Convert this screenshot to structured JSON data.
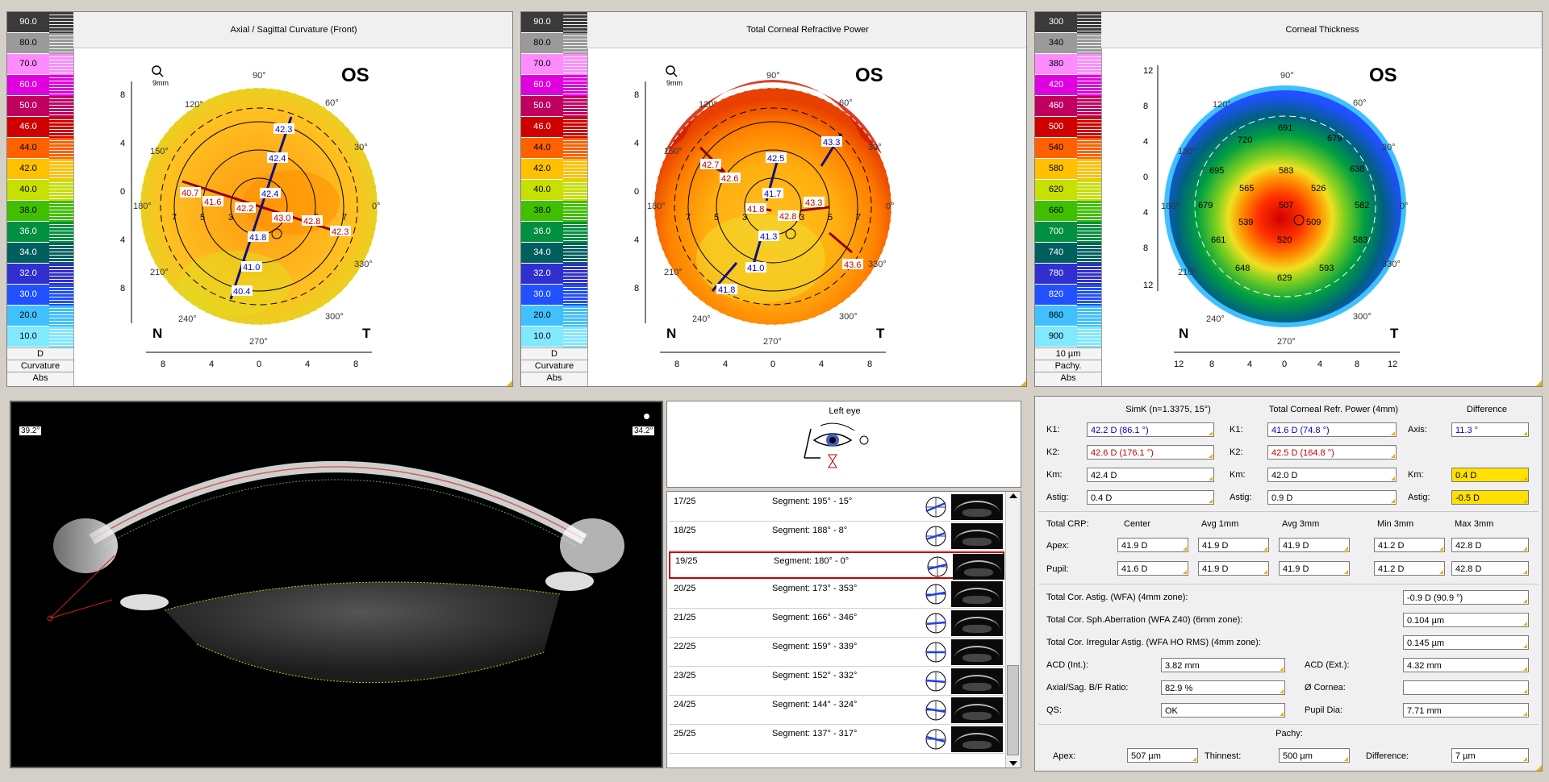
{
  "maps": [
    {
      "title": "Axial / Sagittal Curvature (Front)",
      "eye": "OS",
      "zoom": "9mm",
      "nasal": "N",
      "temporal": "T",
      "scale": [
        "90.0",
        "80.0",
        "70.0",
        "60.0",
        "50.0",
        "46.0",
        "44.0",
        "42.0",
        "40.0",
        "38.0",
        "36.0",
        "34.0",
        "32.0",
        "30.0",
        "20.0",
        "10.0"
      ],
      "scale_colors": [
        "#3a3a3a",
        "#9a9a9a",
        "#ff8cff",
        "#e000e0",
        "#c00060",
        "#d00000",
        "#ff6000",
        "#ffc000",
        "#c8e000",
        "#40c000",
        "#009040",
        "#006060",
        "#3030d0",
        "#2050ff",
        "#40c0ff",
        "#80e8ff"
      ],
      "scale_footer": [
        "D",
        "Curvature",
        "Abs"
      ],
      "x_ticks": [
        "8",
        "4",
        "0",
        "4",
        "8"
      ],
      "y_ticks": [
        "8",
        "4",
        "0",
        "4",
        "8"
      ],
      "angles": [
        "90°",
        "60°",
        "30°",
        "0°",
        "330°",
        "300°",
        "270°",
        "240°",
        "210°",
        "180°",
        "150°",
        "120°"
      ],
      "ring_labels": [
        "7",
        "5",
        "3",
        "3",
        "5",
        "7"
      ],
      "values": [
        "42.3",
        "42.4",
        "42.4",
        "41.8",
        "41.0",
        "40.4",
        "40.7",
        "41.6",
        "42.2",
        "43.0",
        "42.8",
        "42.3"
      ]
    },
    {
      "title": "Total Corneal Refractive Power",
      "eye": "OS",
      "zoom": "9mm",
      "nasal": "N",
      "temporal": "T",
      "scale": [
        "90.0",
        "80.0",
        "70.0",
        "60.0",
        "50.0",
        "46.0",
        "44.0",
        "42.0",
        "40.0",
        "38.0",
        "36.0",
        "34.0",
        "32.0",
        "30.0",
        "20.0",
        "10.0"
      ],
      "scale_colors": [
        "#3a3a3a",
        "#9a9a9a",
        "#ff8cff",
        "#e000e0",
        "#c00060",
        "#d00000",
        "#ff6000",
        "#ffc000",
        "#c8e000",
        "#40c000",
        "#009040",
        "#006060",
        "#3030d0",
        "#2050ff",
        "#40c0ff",
        "#80e8ff"
      ],
      "scale_footer": [
        "D",
        "Curvature",
        "Abs"
      ],
      "x_ticks": [
        "8",
        "4",
        "0",
        "4",
        "8"
      ],
      "y_ticks": [
        "8",
        "4",
        "0",
        "4",
        "8"
      ],
      "angles": [
        "90°",
        "60°",
        "30°",
        "0°",
        "330°",
        "300°",
        "270°",
        "240°",
        "210°",
        "180°",
        "150°",
        "120°"
      ],
      "ring_labels": [
        "7",
        "5",
        "3",
        "3",
        "5",
        "7"
      ],
      "values": [
        "43.3",
        "42.5",
        "41.7",
        "41.3",
        "41.0",
        "41.8",
        "42.7",
        "42.6",
        "41.8",
        "42.8",
        "43.3",
        "43.6"
      ]
    },
    {
      "title": "Corneal Thickness",
      "eye": "OS",
      "nasal": "N",
      "temporal": "T",
      "scale": [
        "300",
        "340",
        "380",
        "420",
        "460",
        "500",
        "540",
        "580",
        "620",
        "660",
        "700",
        "740",
        "780",
        "820",
        "860",
        "900"
      ],
      "scale_colors": [
        "#3a3a3a",
        "#9a9a9a",
        "#ff8cff",
        "#e000e0",
        "#c00060",
        "#d00000",
        "#ff6000",
        "#ffc000",
        "#c8e000",
        "#40c000",
        "#009040",
        "#006060",
        "#3030d0",
        "#2050ff",
        "#40c0ff",
        "#80e8ff"
      ],
      "scale_footer": [
        "10 µm",
        "Pachy.",
        "Abs"
      ],
      "x_ticks": [
        "12",
        "8",
        "4",
        "0",
        "4",
        "8",
        "12"
      ],
      "y_ticks": [
        "12",
        "8",
        "4",
        "0",
        "4",
        "8",
        "12"
      ],
      "angles": [
        "90°",
        "60°",
        "30°",
        "0°",
        "330°",
        "300°",
        "270°",
        "240°",
        "210°",
        "180°",
        "150°",
        "120°"
      ],
      "values": [
        "691",
        "679",
        "720",
        "638",
        "583",
        "695",
        "565",
        "526",
        "679",
        "507",
        "509",
        "582",
        "539",
        "520",
        "661",
        "583",
        "648",
        "593",
        "629"
      ]
    }
  ],
  "scheimpflug": {
    "left_angle": "39.2°",
    "right_angle": "34.2°"
  },
  "segments": {
    "header": "Left eye",
    "rows": [
      {
        "n": "17/25",
        "seg": "Segment: 195° - 15°"
      },
      {
        "n": "18/25",
        "seg": "Segment: 188° - 8°"
      },
      {
        "n": "19/25",
        "seg": "Segment: 180° - 0°"
      },
      {
        "n": "20/25",
        "seg": "Segment: 173° - 353°"
      },
      {
        "n": "21/25",
        "seg": "Segment: 166° - 346°"
      },
      {
        "n": "22/25",
        "seg": "Segment: 159° - 339°"
      },
      {
        "n": "23/25",
        "seg": "Segment: 152° - 332°"
      },
      {
        "n": "24/25",
        "seg": "Segment: 144° - 324°"
      },
      {
        "n": "25/25",
        "seg": "Segment: 137° - 317°"
      }
    ]
  },
  "results": {
    "simk_header": "SimK (n=1.3375, 15°)",
    "tcrp_header": "Total Corneal Refr. Power (4mm)",
    "diff_header": "Difference",
    "k1_label": "K1:",
    "k2_label": "K2:",
    "km_label": "Km:",
    "astig_label": "Astig:",
    "axis_label": "Axis:",
    "simk_k1": "42.2 D (86.1 °)",
    "simk_k2": "42.6 D (176.1 °)",
    "simk_km": "42.4 D",
    "simk_astig": "0.4 D",
    "tcrp_k1": "41.6 D (74.8 °)",
    "tcrp_k2": "42.5 D (164.8 °)",
    "tcrp_km": "42.0 D",
    "tcrp_astig": "0.9 D",
    "diff_axis": "11.3 °",
    "diff_km": "0.4 D",
    "diff_astig": "-0.5 D",
    "crp_label": "Total CRP:",
    "crp_cols": [
      "Center",
      "Avg 1mm",
      "Avg 3mm",
      "Min 3mm",
      "Max 3mm"
    ],
    "apex_label": "Apex:",
    "pupil_label": "Pupil:",
    "apex_vals": [
      "41.9 D",
      "41.9 D",
      "41.9 D",
      "41.2 D",
      "42.8 D"
    ],
    "pupil_vals": [
      "41.6 D",
      "41.9 D",
      "41.9 D",
      "41.2 D",
      "42.8 D"
    ],
    "astig_wfa_label": "Total Cor. Astig. (WFA) (4mm zone):",
    "astig_wfa": "-0.9 D (90.9 °)",
    "sph_label": "Total Cor. Sph.Aberration (WFA Z40) (6mm zone):",
    "sph": "0.104 µm",
    "irr_label": "Total Cor. Irregular Astig. (WFA HO RMS) (4mm zone):",
    "irr": "0.145 µm",
    "acd_int_label": "ACD (Int.):",
    "acd_int": "3.82 mm",
    "acd_ext_label": "ACD (Ext.):",
    "acd_ext": "4.32 mm",
    "bf_label": "Axial/Sag. B/F Ratio:",
    "bf": "82.9 %",
    "cornea_label": "Ø Cornea:",
    "cornea": "",
    "qs_label": "QS:",
    "qs": "OK",
    "pupil_dia_label": "Pupil Dia:",
    "pupil_dia": "7.71 mm",
    "pachy_header": "Pachy:",
    "p_apex_label": "Apex:",
    "p_apex": "507 µm",
    "p_thin_label": "Thinnest:",
    "p_thin": "500 µm",
    "p_diff_label": "Difference:",
    "p_diff": "7 µm"
  }
}
